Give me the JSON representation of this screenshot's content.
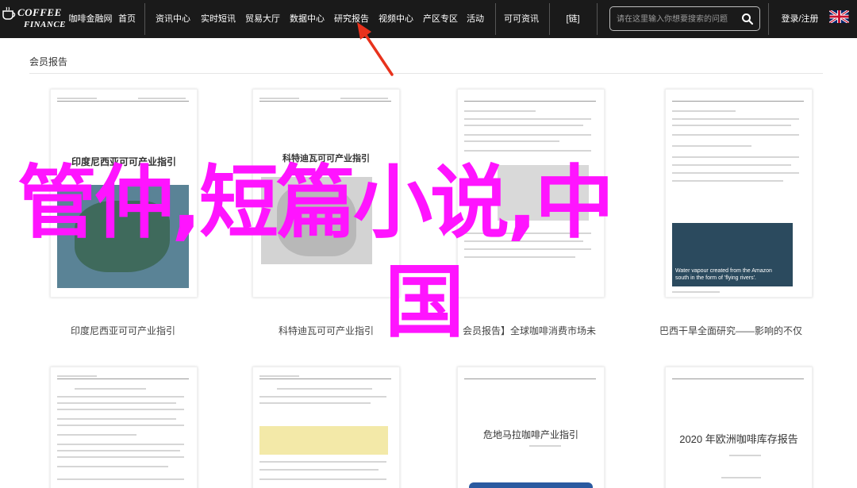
{
  "logo": {
    "line1": "COFFEE",
    "line2": "FINANCE"
  },
  "nav": [
    {
      "label": "咖啡金融网",
      "name": "nav-home-site"
    },
    {
      "label": "首页",
      "name": "nav-home"
    },
    {
      "label": "资讯中心",
      "name": "nav-news"
    },
    {
      "label": "实时短讯",
      "name": "nav-flash"
    },
    {
      "label": "贸易大厅",
      "name": "nav-trade"
    },
    {
      "label": "数据中心",
      "name": "nav-data"
    },
    {
      "label": "研究报告",
      "name": "nav-research"
    },
    {
      "label": "视频中心",
      "name": "nav-video"
    },
    {
      "label": "产区专区",
      "name": "nav-origin"
    },
    {
      "label": "活动",
      "name": "nav-events"
    },
    {
      "label": "可可资讯",
      "name": "nav-cocoa"
    },
    {
      "label": "[链]",
      "name": "nav-chain"
    }
  ],
  "search": {
    "placeholder": "请在这里输入你想要搜索的问题"
  },
  "login": "登录/注册",
  "section": {
    "title": "会员报告"
  },
  "cards": [
    {
      "title": "印度尼西亚可可产业指引",
      "caption": "印度尼西亚可可产业指引"
    },
    {
      "title": "科特迪瓦可可产业指引",
      "caption": "科特迪瓦可可产业指引"
    },
    {
      "title": "",
      "caption": "会员报告】全球咖啡消费市场未"
    },
    {
      "title": "",
      "caption": "巴西干旱全面研究——影响的不仅",
      "map_caption_1": "Water vapour created from the Amazon",
      "map_caption_2": "south in the form of 'flying rivers'."
    },
    {
      "title": "",
      "caption": ""
    },
    {
      "title": "",
      "caption": ""
    },
    {
      "title": "危地马拉咖啡产业指引",
      "caption": ""
    },
    {
      "title": "2020 年欧洲咖啡库存报告",
      "caption": ""
    }
  ],
  "overlay": {
    "line1": "管仲,短篇小说,中",
    "line2": "国"
  },
  "colors": {
    "navbar": "#1a1a1a",
    "overlay": "#ff14ff",
    "arrow": "#e8321c"
  }
}
